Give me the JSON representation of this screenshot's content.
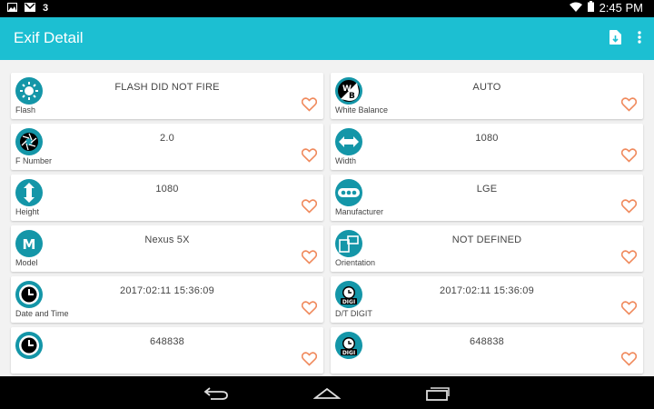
{
  "status_bar": {
    "left_number": "3",
    "time": "2:45 PM",
    "icons": [
      "image-icon",
      "gmail-icon",
      "wifi-icon",
      "battery-icon"
    ]
  },
  "app_bar": {
    "title": "Exif Detail",
    "actions": [
      "export-file-icon",
      "more-vert-icon"
    ]
  },
  "items": [
    {
      "label": "Flash",
      "value": "FLASH DID NOT FIRE",
      "icon": "flash-icon"
    },
    {
      "label": "White Balance",
      "value": "AUTO",
      "icon": "white-balance-icon"
    },
    {
      "label": "F Number",
      "value": "2.0",
      "icon": "aperture-icon"
    },
    {
      "label": "Width",
      "value": "1080",
      "icon": "width-arrows-icon"
    },
    {
      "label": "Height",
      "value": "1080",
      "icon": "height-arrows-icon"
    },
    {
      "label": "Manufacturer",
      "value": "LGE",
      "icon": "manufacturer-icon"
    },
    {
      "label": "Model",
      "value": "Nexus 5X",
      "icon": "model-m-icon"
    },
    {
      "label": "Orientation",
      "value": "NOT DEFINED",
      "icon": "orientation-icon"
    },
    {
      "label": "Date and Time",
      "value": "2017:02:11 15:36:09",
      "icon": "clock-icon"
    },
    {
      "label": "D/T DIGIT",
      "value": "2017:02:11 15:36:09",
      "icon": "digit-clock-icon"
    },
    {
      "label": "",
      "value": "648838",
      "icon": "clock-icon"
    },
    {
      "label": "",
      "value": "648838",
      "icon": "digit-clock-icon"
    }
  ],
  "colors": {
    "app_bar": "#1cbfd2",
    "icon_circle": "#1496a8",
    "heart": "#f08a5d",
    "background": "#f2f2f2"
  },
  "nav_bar": {
    "buttons": [
      "back-icon",
      "home-icon",
      "recents-icon"
    ]
  }
}
